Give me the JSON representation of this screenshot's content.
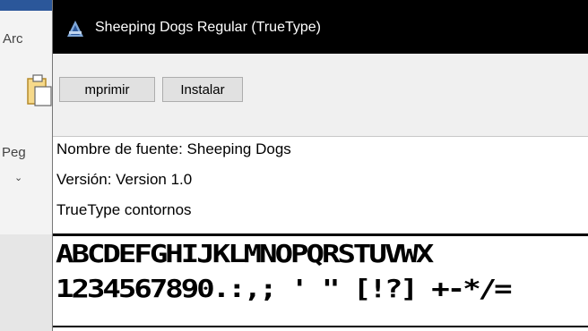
{
  "background_app": {
    "menu_text": "Arc",
    "paste_label": "Peg",
    "chevron": "⌄"
  },
  "window": {
    "title": "Sheeping Dogs Regular (TrueType)",
    "title_icon": "font-file-icon"
  },
  "toolbar": {
    "print_label": "mprimir",
    "install_label": "Instalar"
  },
  "font_info": {
    "name_line": "Nombre de fuente: Sheeping Dogs",
    "version_line": "Versión: Version 1.0",
    "type_line": "TrueType  contornos"
  },
  "sample": {
    "line1": "ABCDEFGHIJKLMNOPQRSTUVWX",
    "line2": "1234567890.:,; ' \" [!?] +-*/="
  },
  "colors": {
    "titlebar": "#000000",
    "accent": "#2b579a"
  }
}
